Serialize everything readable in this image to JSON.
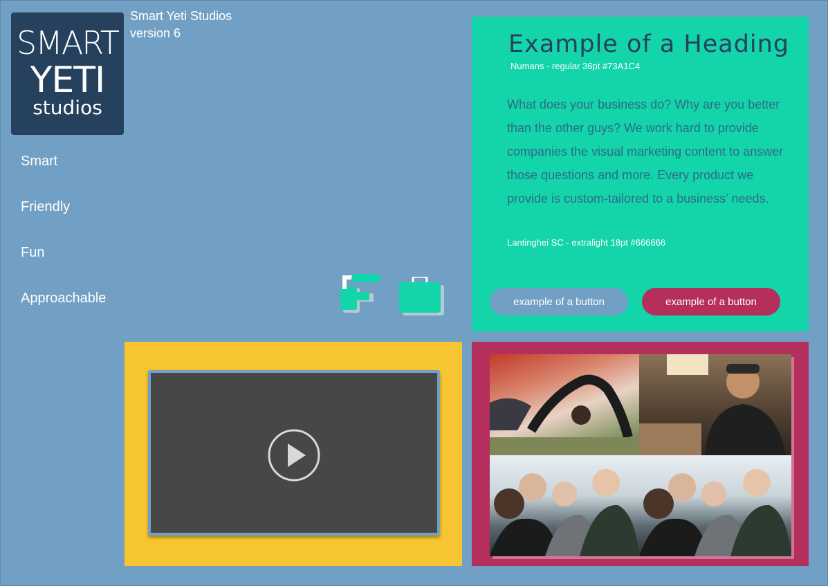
{
  "logo": {
    "line1": "SMART",
    "line2": "YETI",
    "line3": "studios"
  },
  "brand": {
    "name": "Smart Yeti Studios",
    "version": "version 6"
  },
  "nav": [
    "Smart",
    "Friendly",
    "Fun",
    "Approachable"
  ],
  "panel": {
    "heading": "Example of a Heading",
    "heading_note": "Numans - regular 36pt #73A1C4",
    "body": "What does your business do? Why are you better than the other guys? We work hard to provide companies the visual marketing content to answer those questions and more. Every product we provide is custom-tailored to a business’ needs.",
    "body_note": "Lantinghei SC - extralight 18pt #666666",
    "button1": "example of a button",
    "button2": "example of a button"
  },
  "colors": {
    "background": "#72a0c4",
    "green": "#14d4aa",
    "navy": "#26415e",
    "pink": "#b42f5c",
    "yellow": "#f7c531",
    "video": "#474747"
  },
  "icons": [
    "paint-roller-icon",
    "briefcase-icon",
    "play-icon"
  ]
}
